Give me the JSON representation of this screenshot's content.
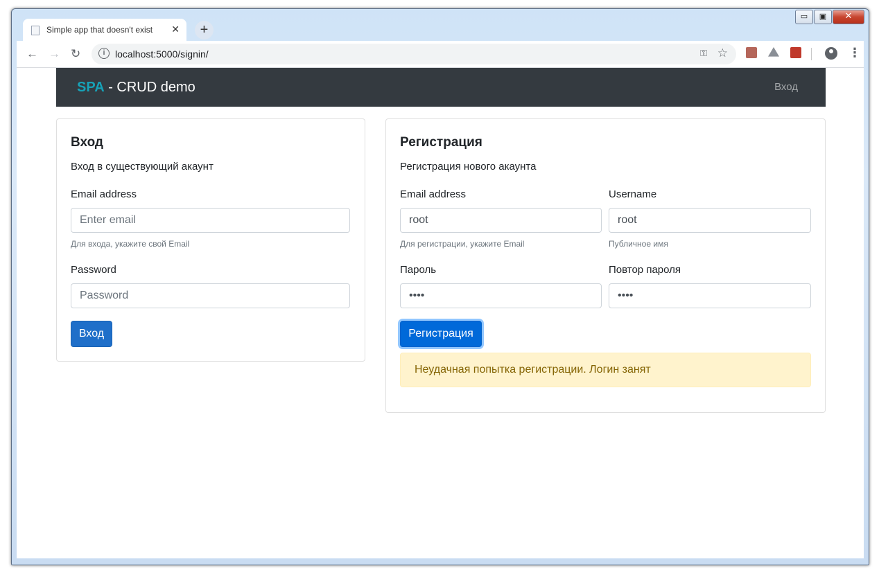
{
  "browser": {
    "tab_title": "Simple app that doesn't exist",
    "tab_close": "✕",
    "new_tab": "+",
    "url": "localhost:5000/signin/",
    "window_controls": {
      "minimize": "▭",
      "restore": "▣",
      "close": "✕"
    }
  },
  "navbar": {
    "brand_accent": "SPA",
    "brand_rest": " - CRUD demo",
    "link": "Вход"
  },
  "login_card": {
    "title": "Вход",
    "subtitle": "Вход в существующий акаунт",
    "email_label": "Email address",
    "email_placeholder": "Enter email",
    "email_help": "Для входа, укажите свой Email",
    "password_label": "Password",
    "password_placeholder": "Password",
    "button": "Вход"
  },
  "register_card": {
    "title": "Регистрация",
    "subtitle": "Регистрация нового акаунта",
    "email_label": "Email address",
    "email_value": "root",
    "email_help": "Для регистрации, укажите Email",
    "username_label": "Username",
    "username_value": "root",
    "username_help": "Публичное имя",
    "password_label": "Пароль",
    "password_value": "••••",
    "password_repeat_label": "Повтор пароля",
    "password_repeat_value": "••••",
    "button": "Регистрация",
    "alert": "Неудачная попытка регистрации. Логин занят"
  },
  "colors": {
    "navbar_bg": "#343a40",
    "brand_accent": "#17a2b8",
    "primary": "#0069d9",
    "alert_bg": "#fff3cd",
    "alert_text": "#856404"
  }
}
